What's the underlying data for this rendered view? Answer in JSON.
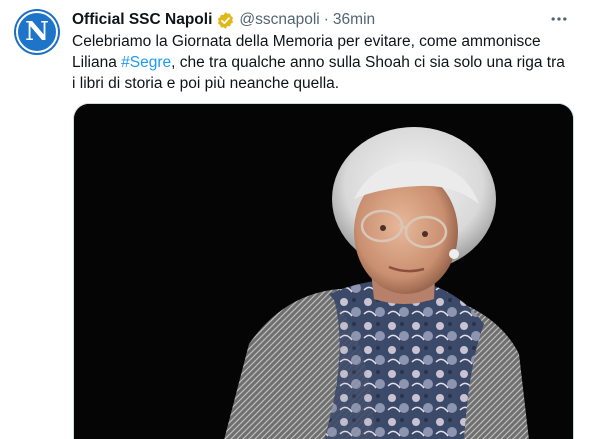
{
  "account": {
    "name": "Official SSC Napoli",
    "handle": "@sscnapoli",
    "separator": "·",
    "time": "36min",
    "avatar_letter": "N",
    "brand_color": "#1e74c9",
    "verified_color": "#e2b719"
  },
  "tweet": {
    "text_before": "Celebriamo la Giornata della Memoria per evitare, come ammonisce Liliana ",
    "hashtag": "#Segre",
    "text_after": ", che tra qualche anno sulla Shoah ci sia solo una riga tra i libri di storia e poi più neanche quella.",
    "hashtag_color": "#1d9bf0"
  },
  "media": {
    "background": "#050505"
  },
  "icons": {
    "more": "more-icon",
    "verified": "verified-badge-icon"
  }
}
